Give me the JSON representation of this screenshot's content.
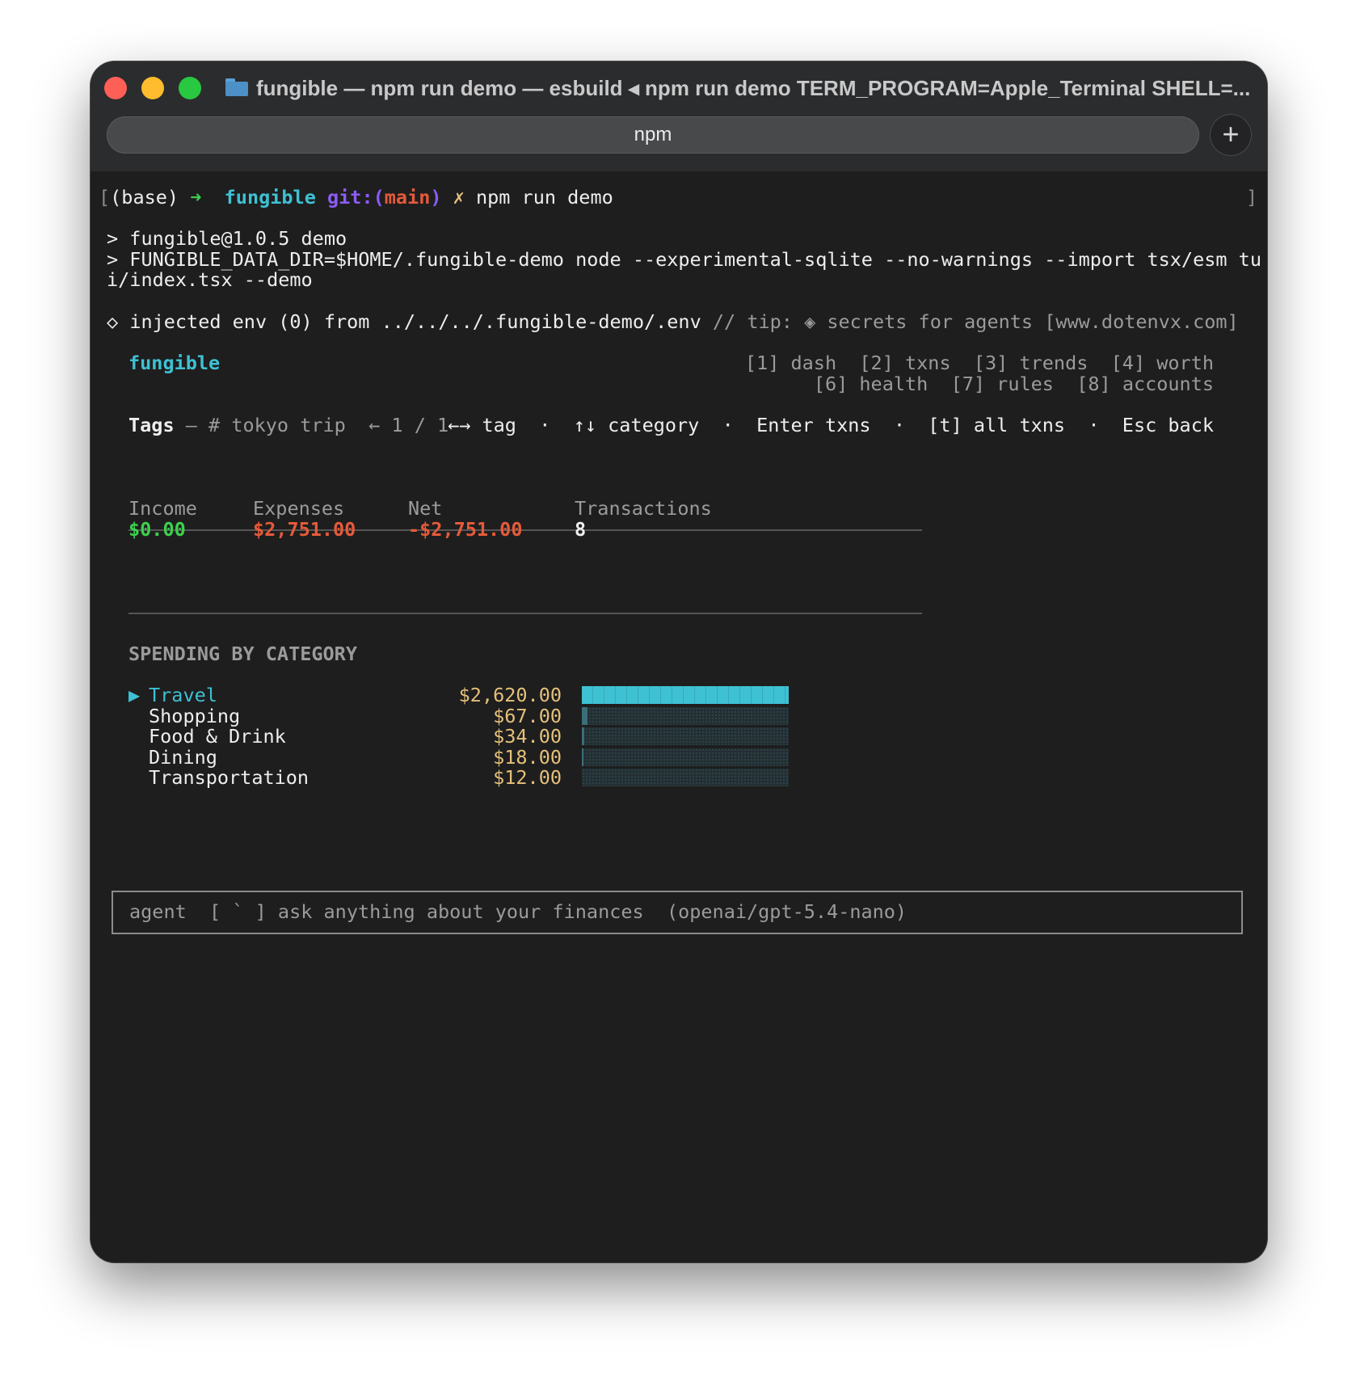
{
  "window": {
    "title": "fungible — npm run demo — esbuild ◂ npm run demo TERM_PROGRAM=Apple_Terminal SHELL=...",
    "tab_label": "npm",
    "new_tab": "+"
  },
  "prompt": {
    "open_bracket": "[",
    "base": "(base)",
    "arrow": "➜",
    "dir": "fungible",
    "git_label": "git:(",
    "branch": "main",
    "git_close": ")",
    "dirty": "✗",
    "command": "npm run demo",
    "close_bracket": "]"
  },
  "npm_output": {
    "line1": "> fungible@1.0.5 demo",
    "line2": "> FUNGIBLE_DATA_DIR=$HOME/.fungible-demo node --experimental-sqlite --no-warnings --import tsx/esm tu",
    "line3": "i/index.tsx --demo"
  },
  "dotenv": {
    "marker": "◇",
    "text": "injected env (0) from ../../../.fungible-demo/.env",
    "tip": "// tip: ◈ secrets for agents [www.dotenvx.com]"
  },
  "app": {
    "name": "fungible",
    "nav_row1": "[1] dash  [2] txns  [3] trends  [4] worth",
    "nav_row2": "[6] health  [7] rules  [8] accounts"
  },
  "tags_bar": {
    "title": "Tags",
    "separator": " — ",
    "tag_name": "# tokyo trip",
    "pager": "← 1 / 1",
    "hints": "←→ tag  ·  ↑↓ category  ·  Enter txns  ·  [t] all txns  ·  Esc back"
  },
  "summary": {
    "income_label": "Income",
    "income_value": "$0.00",
    "expenses_label": "Expenses",
    "expenses_value": "$2,751.00",
    "net_label": "Net",
    "net_value": "-$2,751.00",
    "transactions_label": "Transactions",
    "transactions_value": "8"
  },
  "spending": {
    "heading": "SPENDING BY CATEGORY",
    "selected_marker": "▶",
    "rows": [
      {
        "name": "Travel",
        "amount": "$2,620.00",
        "fraction": 1.0
      },
      {
        "name": "Shopping",
        "amount": "$67.00",
        "fraction": 0.0256
      },
      {
        "name": "Food & Drink",
        "amount": "$34.00",
        "fraction": 0.013
      },
      {
        "name": "Dining",
        "amount": "$18.00",
        "fraction": 0.0069
      },
      {
        "name": "Transportation",
        "amount": "$12.00",
        "fraction": 0.0046
      }
    ]
  },
  "agent": {
    "placeholder": "agent  [ ` ] ask anything about your finances  (openai/gpt-5.4-nano)"
  },
  "colors": {
    "accent": "#3ec1d3",
    "income": "#3ccf4e",
    "expense": "#e55a3a",
    "amount": "#e5c07b",
    "terminal_bg": "#1e1e1e"
  }
}
